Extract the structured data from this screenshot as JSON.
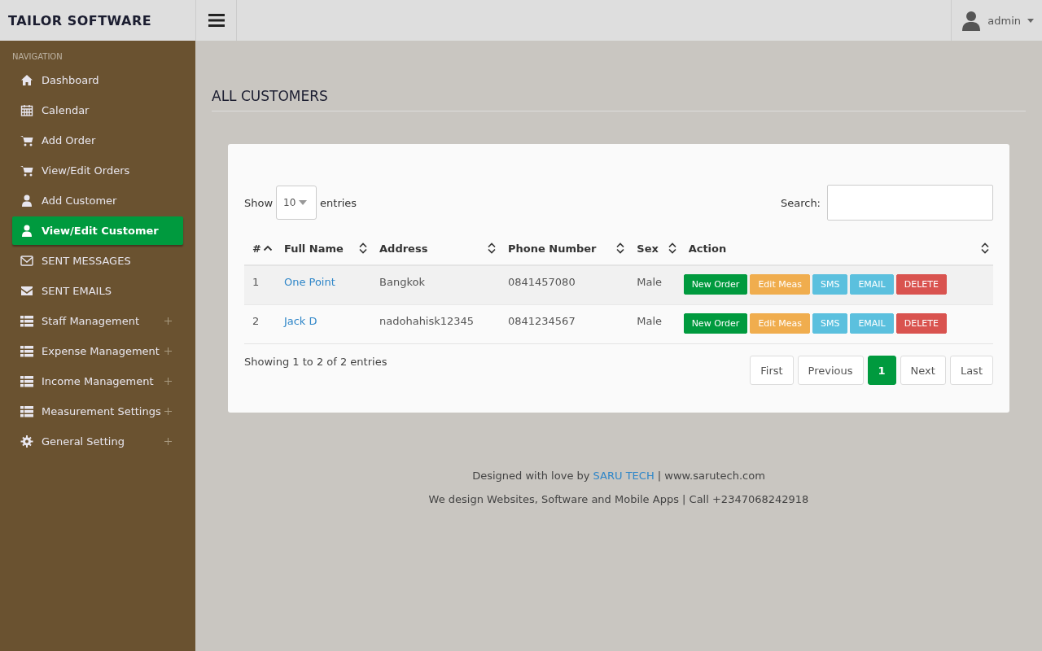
{
  "brand": "TAILOR SOFTWARE",
  "user": {
    "name": "admin"
  },
  "sidebar": {
    "heading": "NAVIGATION",
    "items": [
      {
        "label": "Dashboard",
        "kind": "home",
        "selected": false,
        "expandable": false
      },
      {
        "label": "Calendar",
        "kind": "calendar",
        "selected": false,
        "expandable": false
      },
      {
        "label": "Add Order",
        "kind": "cart",
        "selected": false,
        "expandable": false
      },
      {
        "label": "View/Edit Orders",
        "kind": "cart",
        "selected": false,
        "expandable": false
      },
      {
        "label": "Add Customer",
        "kind": "user",
        "selected": false,
        "expandable": false
      },
      {
        "label": "View/Edit Customer",
        "kind": "user",
        "selected": true,
        "expandable": false
      },
      {
        "label": "SENT MESSAGES",
        "kind": "envelope-outline",
        "selected": false,
        "expandable": false
      },
      {
        "label": "SENT EMAILS",
        "kind": "envelope",
        "selected": false,
        "expandable": false
      },
      {
        "label": "Staff Management",
        "kind": "list",
        "selected": false,
        "expandable": true
      },
      {
        "label": "Expense Management",
        "kind": "list",
        "selected": false,
        "expandable": true
      },
      {
        "label": "Income Management",
        "kind": "list",
        "selected": false,
        "expandable": true
      },
      {
        "label": "Measurement Settings",
        "kind": "list",
        "selected": false,
        "expandable": true
      },
      {
        "label": "General Setting",
        "kind": "gear",
        "selected": false,
        "expandable": true
      }
    ]
  },
  "page_title": "ALL CUSTOMERS",
  "length": {
    "before": "Show",
    "value": "10",
    "after": "entries"
  },
  "search": {
    "label": "Search:"
  },
  "table": {
    "columns": [
      {
        "label": "#",
        "sorted": true
      },
      {
        "label": "Full Name",
        "sorted": false
      },
      {
        "label": "Address",
        "sorted": false
      },
      {
        "label": "Phone Number",
        "sorted": false
      },
      {
        "label": "Sex",
        "sorted": false
      },
      {
        "label": "Action",
        "sorted": false
      }
    ],
    "rows": [
      {
        "index": "1",
        "name": "One Point",
        "address": "Bangkok",
        "phone": "0841457080",
        "sex": "Male",
        "actions": [
          {
            "label": "New Order",
            "color": "#009a3e"
          },
          {
            "label": "Edit Meas",
            "color": "#f0ad4e"
          },
          {
            "label": "SMS",
            "color": "#5bc0de"
          },
          {
            "label": "EMAIL",
            "color": "#5bc0de"
          },
          {
            "label": "DELETE",
            "color": "#d9534f"
          }
        ]
      },
      {
        "index": "2",
        "name": "Jack D",
        "address": "nadohahisk12345",
        "phone": "0841234567",
        "sex": "Male",
        "actions": [
          {
            "label": "New Order",
            "color": "#009a3e"
          },
          {
            "label": "Edit Meas",
            "color": "#f0ad4e"
          },
          {
            "label": "SMS",
            "color": "#5bc0de"
          },
          {
            "label": "EMAIL",
            "color": "#5bc0de"
          },
          {
            "label": "DELETE",
            "color": "#d9534f"
          }
        ]
      }
    ]
  },
  "info": "Showing 1 to 2 of 2 entries",
  "pagination": [
    {
      "label": "First",
      "selected": false
    },
    {
      "label": "Previous",
      "selected": false
    },
    {
      "label": "1",
      "selected": true
    },
    {
      "label": "Next",
      "selected": false
    },
    {
      "label": "Last",
      "selected": false
    }
  ],
  "footer": {
    "line1_before": "Designed with love by",
    "link": "SARU TECH",
    "line1_after": "| www.sarutech.com",
    "line2": "We design Websites, Software and Mobile Apps | Call +2347068242918"
  }
}
